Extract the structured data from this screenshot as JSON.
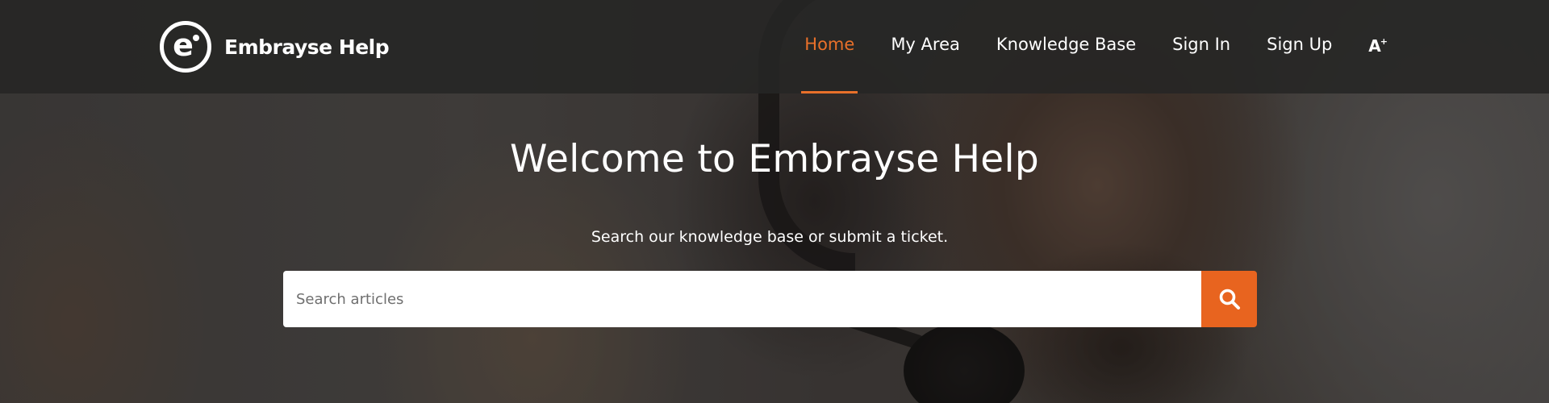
{
  "brand": {
    "name": "Embrayse Help",
    "logo_letter": "e",
    "accent_color": "#e8702a"
  },
  "nav": {
    "items": [
      {
        "label": "Home",
        "active": true
      },
      {
        "label": "My Area",
        "active": false
      },
      {
        "label": "Knowledge Base",
        "active": false
      },
      {
        "label": "Sign In",
        "active": false
      },
      {
        "label": "Sign Up",
        "active": false
      }
    ],
    "accessibility": {
      "letter": "A",
      "superscript": "+",
      "icon": "text-size-icon"
    }
  },
  "hero": {
    "title": "Welcome to Embrayse Help",
    "subtitle": "Search our knowledge base or submit a ticket."
  },
  "search": {
    "placeholder": "Search articles",
    "value": "",
    "button_icon": "search-icon",
    "button_color": "#e8641f"
  }
}
